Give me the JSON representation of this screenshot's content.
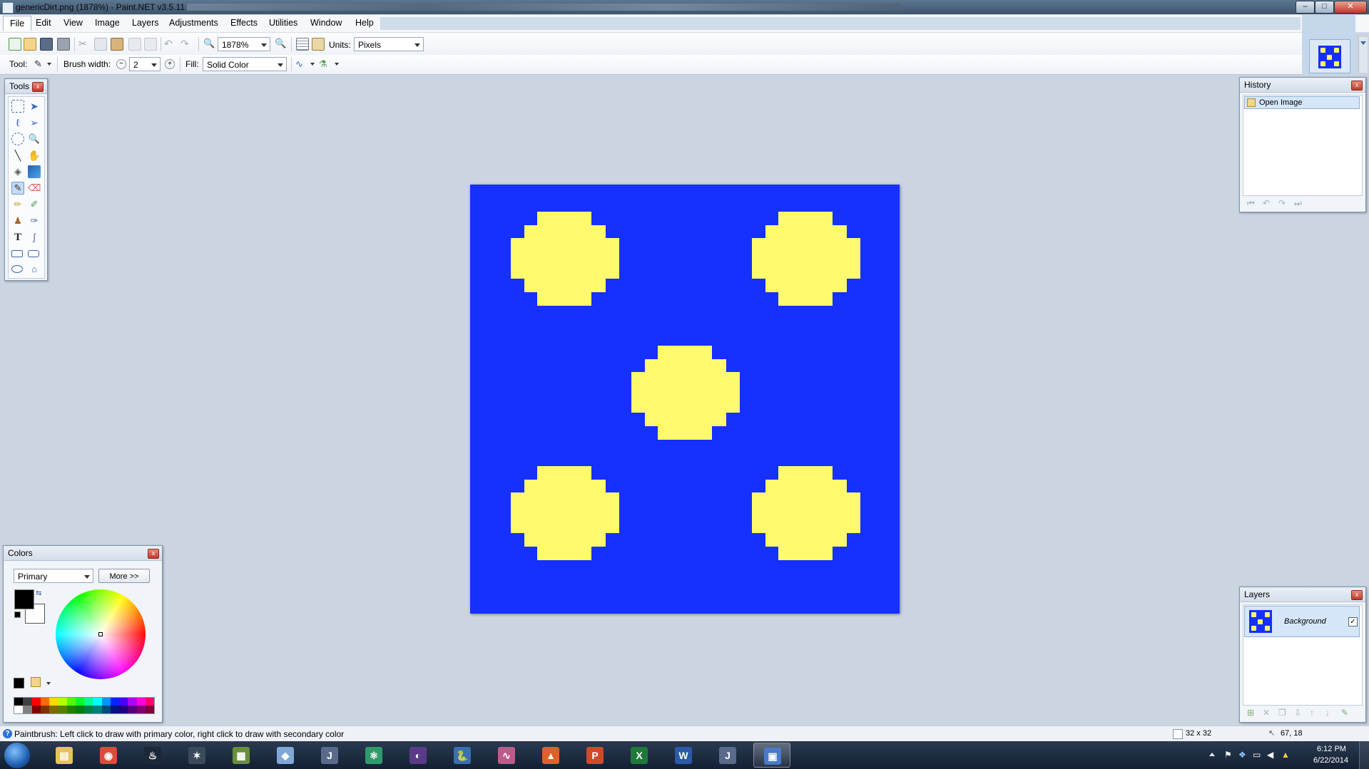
{
  "window": {
    "title": "genericDirt.png (1878%) - Paint.NET v3.5.11",
    "minimize_glyph": "–",
    "maximize_glyph": "□",
    "close_glyph": "✕"
  },
  "menu": {
    "items": [
      "File",
      "Edit",
      "View",
      "Image",
      "Layers",
      "Adjustments",
      "Effects",
      "Utilities",
      "Window",
      "Help"
    ]
  },
  "toolbar1": {
    "zoom_value": "1878%",
    "units_label": "Units:",
    "units_value": "Pixels"
  },
  "toolbar2": {
    "tool_label": "Tool:",
    "brush_width_label": "Brush width:",
    "brush_width_value": "2",
    "fill_label": "Fill:",
    "fill_value": "Solid Color"
  },
  "tools_window": {
    "title": "Tools",
    "selected_tool": "paintbrush"
  },
  "history_window": {
    "title": "History",
    "items": [
      "Open Image"
    ]
  },
  "colors_window": {
    "title": "Colors",
    "mode_value": "Primary",
    "more_button": "More >>",
    "primary_color": "#000000",
    "secondary_color": "#ffffff"
  },
  "layers_window": {
    "title": "Layers",
    "layers": [
      {
        "name": "Background",
        "visible": true
      }
    ]
  },
  "image": {
    "background_color": "#1530ff",
    "dot_color": "#fff96e",
    "dot_count": 5
  },
  "status": {
    "message": "Paintbrush: Left click to draw with primary color, right click to draw with secondary color",
    "image_size": "32 x 32",
    "cursor_position": "67, 18"
  },
  "taskbar": {
    "apps": [
      "start-button",
      "file-explorer",
      "chrome",
      "steam",
      "starcraft",
      "minecraft",
      "3d-app",
      "intellij",
      "atom",
      "eclipse",
      "python",
      "matlab-plot",
      "matlab",
      "powerpoint",
      "excel",
      "word",
      "intellij-2",
      "paint-net"
    ],
    "active_app": "paint-net",
    "time": "6:12 PM",
    "date": "6/22/2014"
  },
  "colors": {
    "accent": "#6c9bd2",
    "canvas_bg": "#cbd5e2"
  }
}
